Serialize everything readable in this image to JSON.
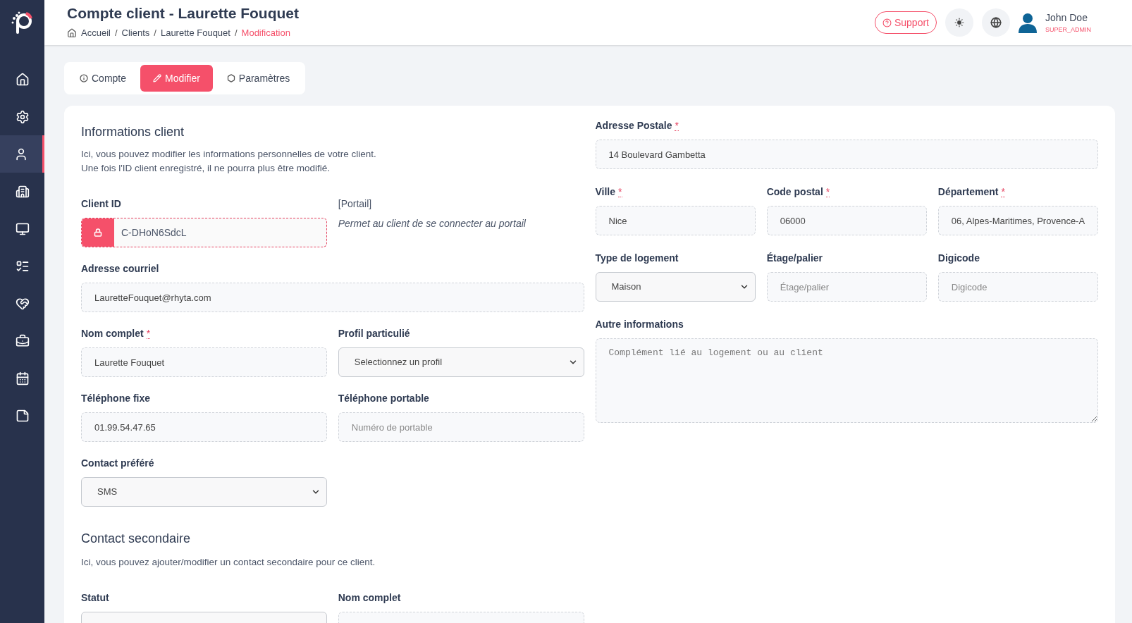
{
  "sidebar": {
    "items": [
      {
        "selected": false
      },
      {
        "selected": false
      },
      {
        "selected": true
      },
      {
        "selected": false
      },
      {
        "selected": false
      },
      {
        "selected": false
      },
      {
        "selected": false
      },
      {
        "selected": false
      },
      {
        "selected": false
      },
      {
        "selected": false
      }
    ]
  },
  "header": {
    "title": "Compte client - Laurette Fouquet",
    "breadcrumb": [
      {
        "label": "Accueil",
        "current": false
      },
      {
        "label": "Clients",
        "current": false
      },
      {
        "label": "Laurette Fouquet",
        "current": false
      },
      {
        "label": "Modification",
        "current": true
      }
    ],
    "separator": "/",
    "support": "Support",
    "user": {
      "name": "John Doe",
      "role": "SUPER_ADMIN"
    }
  },
  "tabs": [
    {
      "label": "Compte",
      "selected": false
    },
    {
      "label": "Modifier",
      "selected": true
    },
    {
      "label": "Paramètres",
      "selected": false
    }
  ],
  "client_info": {
    "title": "Informations client",
    "description": [
      "Ici, vous pouvez modifier les informations personnelles de votre client.",
      "Une fois l'ID client enregistré, il ne pourra plus être modifié."
    ],
    "fields": [
      {
        "kind": "locked",
        "label": "Client ID",
        "value": "C-DHoN6SdcL"
      },
      {
        "kind": "note",
        "label": "[Portail]",
        "note": "Permet au client de se connecter au portail"
      },
      {
        "kind": "text",
        "label": "Adresse courriel",
        "value": "LauretteFouquet@rhyta.com",
        "wide": true
      },
      {
        "kind": "text",
        "label": "Nom complet",
        "required_mark": "*",
        "value": "Laurette Fouquet"
      },
      {
        "kind": "select",
        "label": "Profil particulié",
        "value": "Selectionnez un profil"
      },
      {
        "kind": "text",
        "label": "Téléphone fixe",
        "value": "01.99.54.47.65"
      },
      {
        "kind": "text",
        "label": "Téléphone portable",
        "placeholder": "Numéro de portable"
      },
      {
        "kind": "select",
        "label": "Contact préféré",
        "value": "SMS"
      }
    ]
  },
  "secondary_contact": {
    "title": "Contact secondaire",
    "description": "Ici, vous pouvez ajouter/modifier un contact secondaire pour ce client.",
    "fields": [
      {
        "kind": "select",
        "label": "Statut"
      },
      {
        "kind": "text",
        "label": "Nom complet"
      }
    ]
  },
  "address": {
    "fields": [
      {
        "kind": "text",
        "label": "Adresse Postale",
        "required_mark": "*",
        "value": "14 Boulevard Gambetta",
        "wide": true
      },
      {
        "kind": "text",
        "label": "Ville",
        "required_mark": "*",
        "value": "Nice"
      },
      {
        "kind": "text",
        "label": "Code postal",
        "required_mark": "*",
        "value": "06000"
      },
      {
        "kind": "text",
        "label": "Département",
        "required_mark": "*",
        "value": "06, Alpes-Maritimes, Provence-A"
      },
      {
        "kind": "select",
        "label": "Type de logement",
        "value": "Maison"
      },
      {
        "kind": "text",
        "label": "Étage/palier",
        "placeholder": "Étage/palier"
      },
      {
        "kind": "text",
        "label": "Digicode",
        "placeholder": "Digicode"
      },
      {
        "kind": "textarea",
        "label": "Autre informations",
        "placeholder": "Complément lié au logement ou au client",
        "wide": true
      }
    ]
  }
}
